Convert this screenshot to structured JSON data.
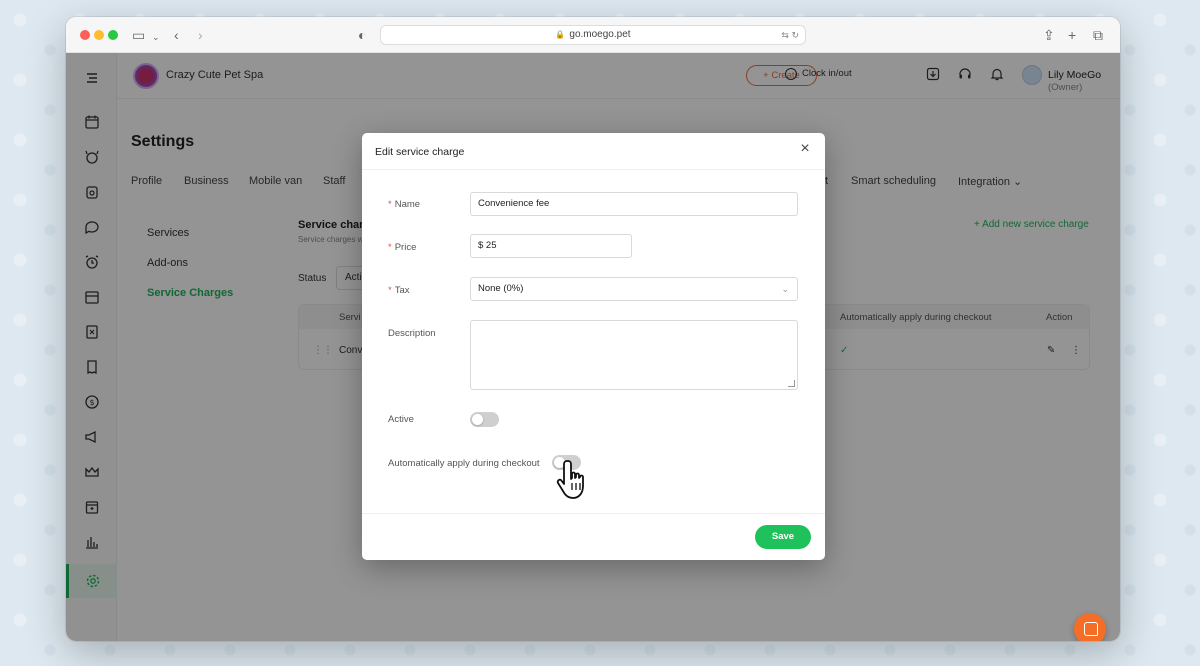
{
  "browser": {
    "url": "go.moego.pet"
  },
  "topbar": {
    "business_name": "Crazy Cute Pet Spa",
    "create_label": "+ Create",
    "clock_label": "Clock in/out",
    "user_name": "Lily MoeGo",
    "user_role": "(Owner)"
  },
  "page": {
    "title": "Settings",
    "tabs": [
      "Profile",
      "Business",
      "Mobile van",
      "Staff",
      "t",
      "Smart scheduling",
      "Integration"
    ],
    "subnav": [
      "Services",
      "Add-ons",
      "Service Charges"
    ],
    "active_subnav": "Service Charges"
  },
  "service_charges": {
    "title": "Service charg",
    "subtitle": "Service charges w",
    "add_new": "+ Add new service charge",
    "status_label": "Status",
    "status_value": "Acti",
    "columns": [
      "Servi",
      "Automatically apply during checkout",
      "Action"
    ],
    "rows": [
      {
        "name": "Conv",
        "auto_apply": true
      }
    ]
  },
  "modal": {
    "title": "Edit service charge",
    "fields": {
      "name_label": "Name",
      "name_value": "Convenience fee",
      "price_label": "Price",
      "price_value": "$ 25",
      "tax_label": "Tax",
      "tax_value": "None (0%)",
      "description_label": "Description",
      "description_value": "",
      "active_label": "Active",
      "active_on": false,
      "auto_apply_label": "Automatically apply during checkout",
      "auto_apply_on": false
    },
    "save_label": "Save"
  },
  "colors": {
    "brand_green": "#1fb45c",
    "accent_orange": "#f26a3e",
    "required_red": "#f04e3a"
  },
  "icons": {
    "sidebar": [
      "menu-icon",
      "calendar-icon",
      "pet-icon",
      "grooming-icon",
      "chat-icon",
      "alarm-icon",
      "schedule-icon",
      "report-card-icon",
      "invoice-icon",
      "payment-icon",
      "marketing-icon",
      "crown-icon",
      "box-icon",
      "chart-icon",
      "settings-icon"
    ]
  }
}
